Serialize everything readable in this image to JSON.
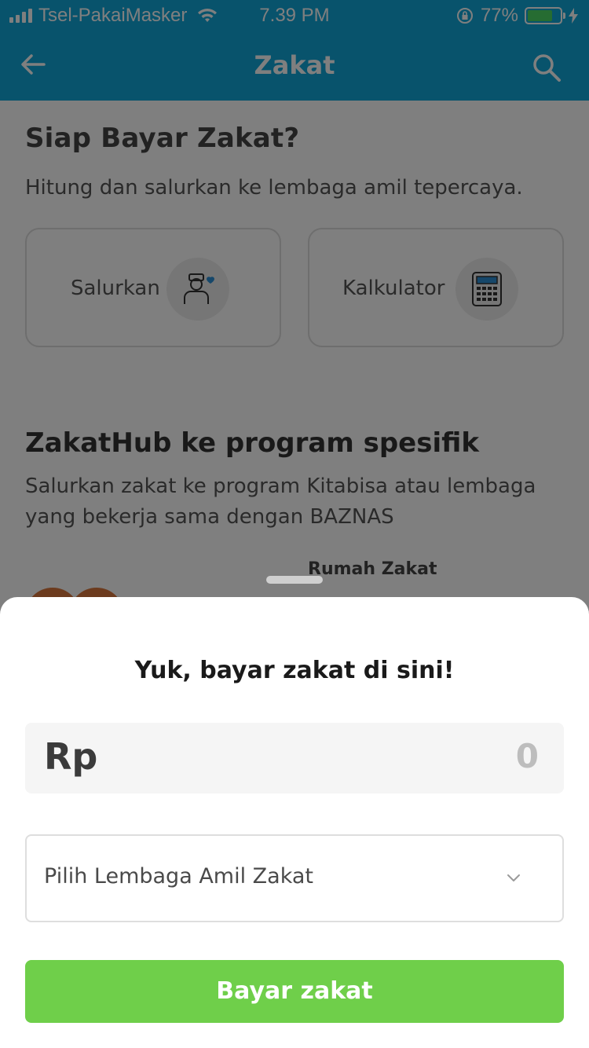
{
  "status_bar": {
    "carrier": "Tsel-PakaiMasker",
    "time": "7.39 PM",
    "battery_percent": "77%"
  },
  "app_bar": {
    "title": "Zakat",
    "back_icon": "arrow-left-icon",
    "search_icon": "search-icon"
  },
  "intro": {
    "title": "Siap Bayar Zakat?",
    "subtitle": "Hitung dan salurkan ke lembaga amil tepercaya.",
    "cards": [
      {
        "label": "Salurkan",
        "icon": "donate-person-icon"
      },
      {
        "label": "Kalkulator",
        "icon": "calculator-icon"
      }
    ]
  },
  "zakathub": {
    "title": "ZakatHub ke program spesifik",
    "description": "Salurkan zakat ke program Kitabisa atau lembaga yang bekerja sama dengan BAZNAS",
    "org_label": "Rumah Zakat"
  },
  "sheet": {
    "title": "Yuk, bayar zakat di sini!",
    "currency": "Rp",
    "amount": "0",
    "select_placeholder": "Pilih Lembaga Amil Zakat",
    "pay_button": "Bayar zakat"
  },
  "colors": {
    "primary": "#10a7d9",
    "pay_button": "#6fcf4a",
    "battery": "#4cd964"
  }
}
